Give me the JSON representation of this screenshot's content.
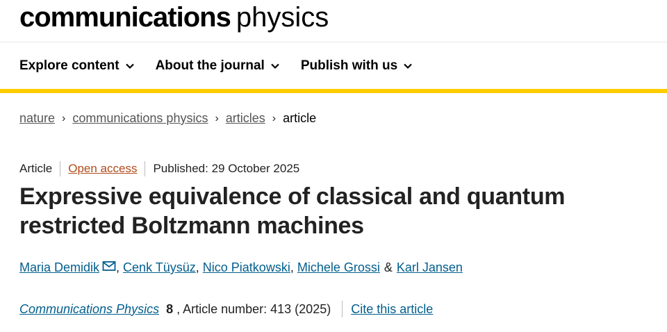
{
  "header": {
    "brand_bold": "communications",
    "brand_light": "physics"
  },
  "nav": {
    "items": [
      {
        "label": "Explore content"
      },
      {
        "label": "About the journal"
      },
      {
        "label": "Publish with us"
      }
    ]
  },
  "breadcrumb": {
    "items": [
      "nature",
      "communications physics",
      "articles"
    ],
    "current": "article"
  },
  "article": {
    "type": "Article",
    "access": "Open access",
    "published": "Published: 29 October 2025",
    "title": "Expressive equivalence of classical and quantum restricted Boltzmann machines",
    "authors": [
      "Maria Demidik",
      "Cenk Tüysüz",
      "Nico Piatkowski",
      "Michele Grossi",
      "Karl Jansen"
    ],
    "author_sep": ",",
    "author_amp": "&",
    "journal": "Communications Physics",
    "volume": "8",
    "article_number": ", Article number: 413 (2025)",
    "cite_label": "Cite this article"
  },
  "colors": {
    "accent_yellow": "#ffcc00",
    "link_blue": "#025e8d",
    "open_access_orange": "#b04b1b"
  },
  "icons": {
    "nav_chevron": "chevron-down-icon",
    "breadcrumb_separator": "chevron-right-icon",
    "author_contact": "mail-icon"
  }
}
